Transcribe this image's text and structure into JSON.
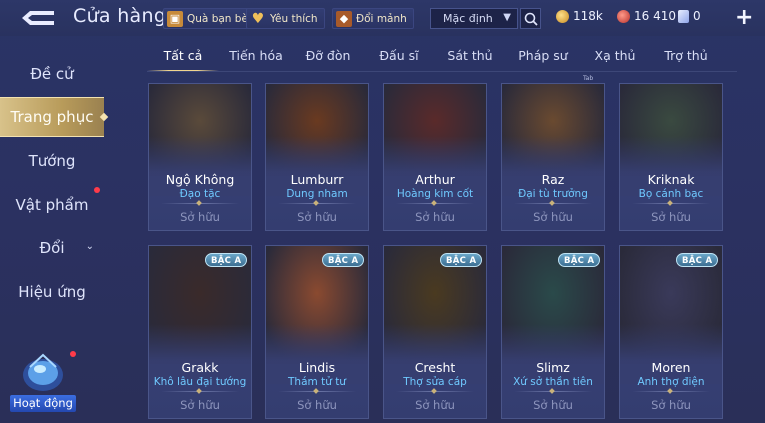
{
  "header": {
    "title": "Cửa hàng",
    "chips": [
      {
        "label": "Quà bạn bè",
        "icon": "gift-icon"
      },
      {
        "label": "Yêu thích",
        "icon": "heart-icon"
      },
      {
        "label": "Đổi mảnh",
        "icon": "fragment-icon"
      }
    ],
    "sort_value": "Mặc định",
    "currencies": [
      {
        "value": "118k",
        "icon": "gold-coin-icon",
        "color": "#d8a93a"
      },
      {
        "value": "16 410",
        "icon": "ruby-icon",
        "color": "#d84a3a"
      },
      {
        "value": "0",
        "icon": "voucher-icon",
        "color": "#9fb6ff"
      }
    ]
  },
  "sidebar": {
    "items": [
      {
        "label": "Đề cử"
      },
      {
        "label": "Trang phục"
      },
      {
        "label": "Tướng"
      },
      {
        "label": "Vật phẩm"
      },
      {
        "label": "Đổi"
      },
      {
        "label": "Hiệu ứng"
      }
    ],
    "event_label": "Hoạt động"
  },
  "tabs": [
    {
      "label": "Tất cả"
    },
    {
      "label": "Tiến hóa"
    },
    {
      "label": "Đỡ đòn"
    },
    {
      "label": "Đấu sĩ"
    },
    {
      "label": "Sát thủ"
    },
    {
      "label": "Pháp sư"
    },
    {
      "label": "Xạ thủ"
    },
    {
      "label": "Trợ thủ"
    }
  ],
  "tab_tag": "Tab",
  "cards": [
    {
      "name": "Ngộ Không",
      "skin": "Đạo tặc",
      "status": "Sở hữu",
      "badge": "",
      "bg": "#5a4a3a"
    },
    {
      "name": "Lumburr",
      "skin": "Dung nham",
      "status": "Sở hữu",
      "badge": "",
      "bg": "#6a3a20"
    },
    {
      "name": "Arthur",
      "skin": "Hoàng kim cốt",
      "status": "Sở hữu",
      "badge": "",
      "bg": "#5a2a2a"
    },
    {
      "name": "Raz",
      "skin": "Đại tù trưởng",
      "status": "Sở hữu",
      "badge": "",
      "bg": "#6a4a30"
    },
    {
      "name": "Kriknak",
      "skin": "Bọ cánh bạc",
      "status": "Sở hữu",
      "badge": "",
      "bg": "#3a4a40"
    },
    {
      "name": "Grakk",
      "skin": "Khô lâu đại tướng",
      "status": "Sở hữu",
      "badge": "BẬC A",
      "bg": "#3a2a2a"
    },
    {
      "name": "Lindis",
      "skin": "Thám tử tư",
      "status": "Sở hữu",
      "badge": "BẬC A",
      "bg": "#8a4a30"
    },
    {
      "name": "Cresht",
      "skin": "Thợ sửa cáp",
      "status": "Sở hữu",
      "badge": "BẬC A",
      "bg": "#4a3a20"
    },
    {
      "name": "Slimz",
      "skin": "Xứ sở thần tiên",
      "status": "Sở hữu",
      "badge": "BẬC A",
      "bg": "#2a4a4a"
    },
    {
      "name": "Moren",
      "skin": "Anh thợ điện",
      "status": "Sở hữu",
      "badge": "BẬC A",
      "bg": "#3a3a5a"
    }
  ]
}
